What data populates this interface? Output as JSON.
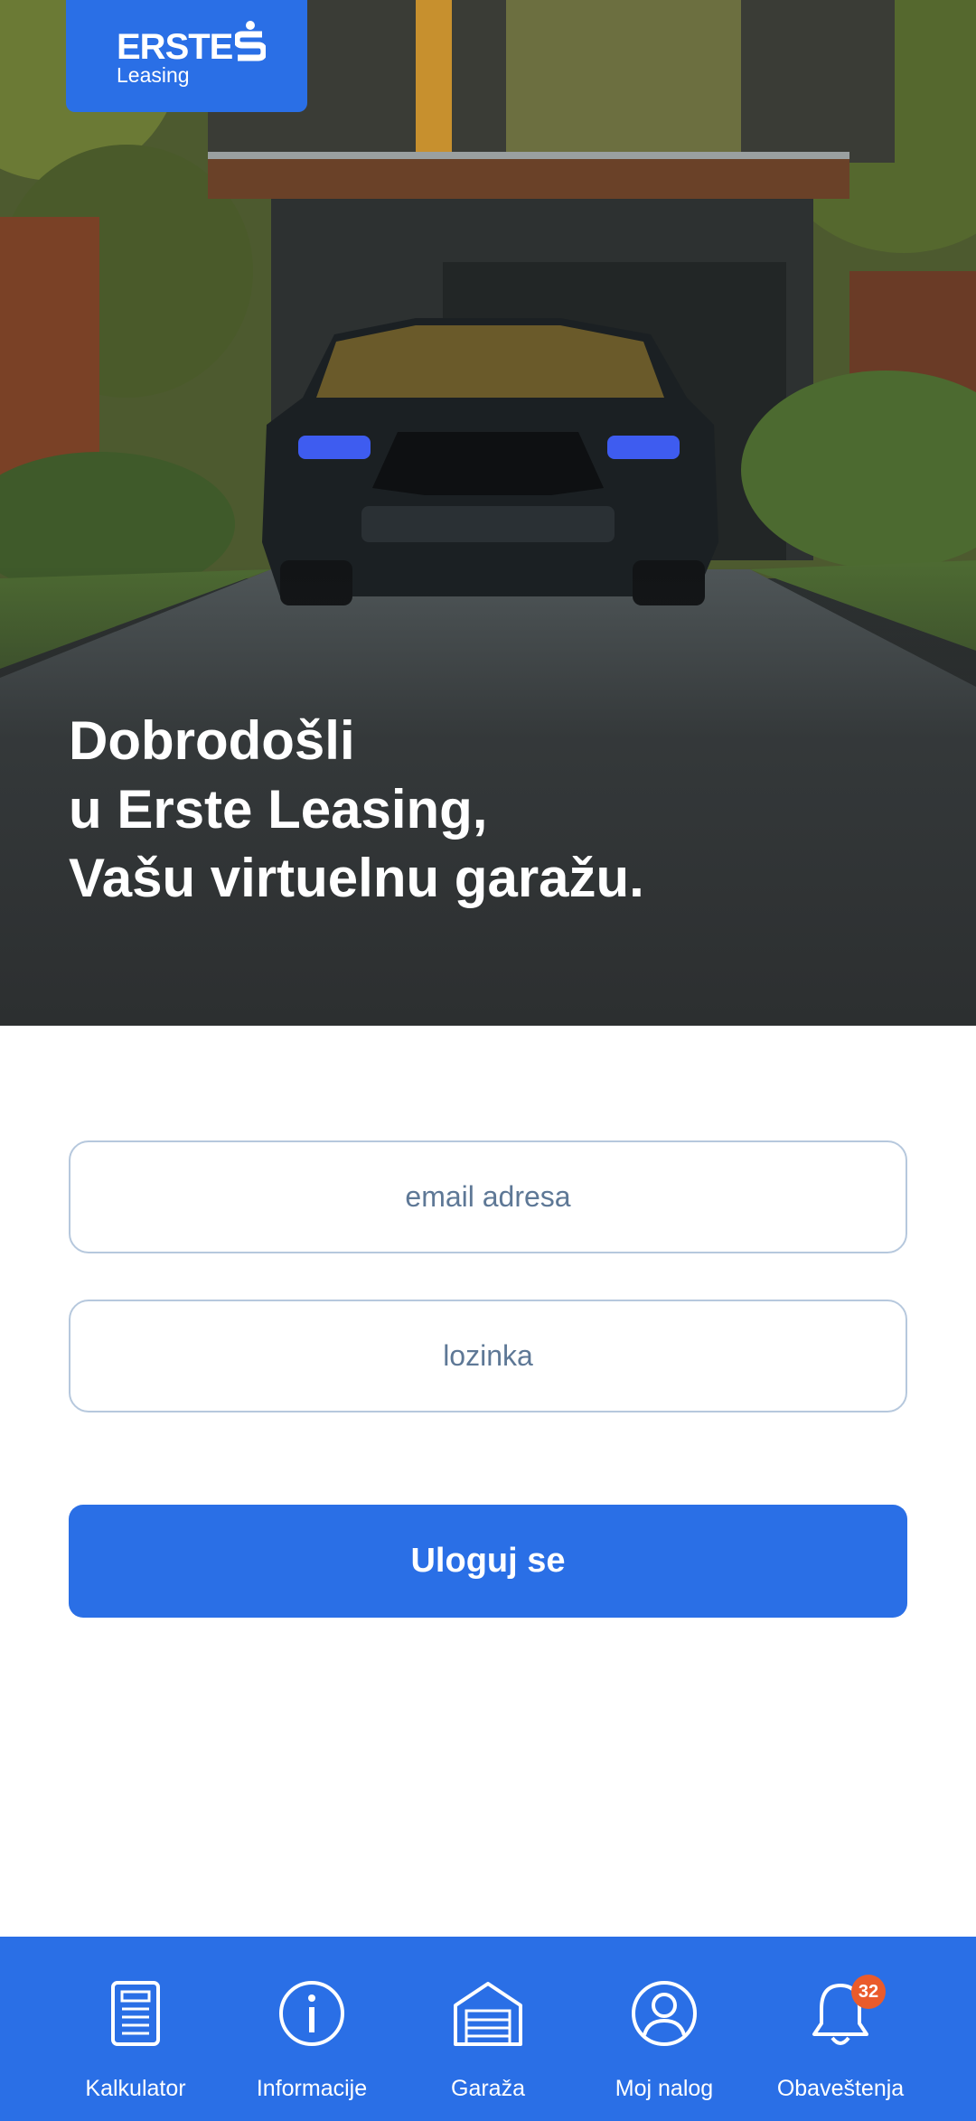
{
  "brand": {
    "name": "ERSTE",
    "sub": "Leasing"
  },
  "hero": {
    "welcome_lines": [
      "Dobrodošli",
      "u Erste Leasing,",
      "Vašu virtuelnu garažu."
    ]
  },
  "login_form": {
    "email_placeholder": "email adresa",
    "password_placeholder": "lozinka",
    "submit_label": "Uloguj se"
  },
  "bottom_nav": {
    "items": [
      {
        "label": "Kalkulator",
        "icon": "calculator-document-icon"
      },
      {
        "label": "Informacije",
        "icon": "info-icon"
      },
      {
        "label": "Garaža",
        "icon": "garage-icon"
      },
      {
        "label": "Moj nalog",
        "icon": "user-account-icon"
      },
      {
        "label": "Obaveštenja",
        "icon": "bell-icon",
        "badge": "32"
      }
    ]
  },
  "colors": {
    "brand_blue": "#2a6fe6",
    "badge_orange": "#ea5b2b",
    "field_border": "#b6c8dd"
  }
}
